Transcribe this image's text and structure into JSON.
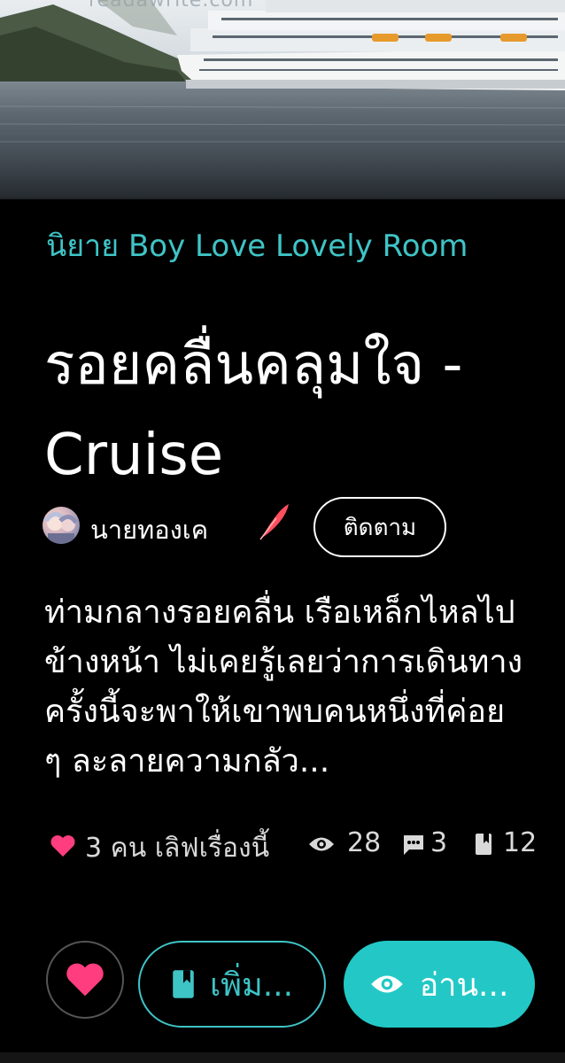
{
  "cover": {
    "url_fragment": "readawrite.com"
  },
  "category": "นิยาย Boy Love Lovely Room",
  "title": "รอยคลื่นคลุมใจ - Cruise",
  "author": {
    "name": "นายทองเค",
    "follow_label": "ติดตาม"
  },
  "synopsis": "ท่ามกลางรอยคลื่น เรือเหล็กไหลไปข้างหน้า ไม่เคยรู้เลยว่าการเดินทางครั้งนี้จะพาให้เขาพบคนหนึ่งที่ค่อย ๆ ละลายความกลัว...",
  "stats": {
    "love_text": "3 คน เลิฟเรื่องนี้",
    "views": "28",
    "comments": "3",
    "chapters": "12"
  },
  "actions": {
    "add_label": "เพิ่ม...",
    "read_label": "อ่าน..."
  },
  "colors": {
    "accent": "#3fc4c6",
    "read_button": "#23c8c6",
    "heart": "#ff3d7f",
    "background": "#000000"
  },
  "icons": [
    "feather-icon",
    "heart-icon",
    "eye-icon",
    "comment-icon",
    "book-icon"
  ]
}
